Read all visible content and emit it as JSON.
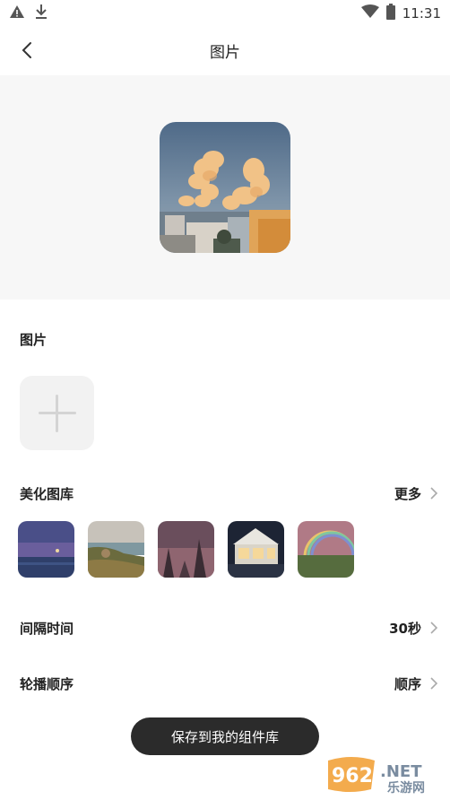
{
  "status_bar": {
    "time": "11:31",
    "icons": [
      "warning-icon",
      "download-icon",
      "wifi-icon",
      "battery-icon"
    ]
  },
  "header": {
    "title": "图片"
  },
  "image_section": {
    "label": "图片"
  },
  "gallery": {
    "label": "美化图库",
    "more_label": "更多",
    "thumbnails": [
      "sea-moon",
      "coast-cliff",
      "pink-dusk",
      "lit-house",
      "rainbow-field"
    ]
  },
  "interval": {
    "label": "间隔时间",
    "value": "30秒"
  },
  "order": {
    "label": "轮播顺序",
    "value": "顺序"
  },
  "save_button": {
    "label": "保存到我的组件库"
  },
  "watermark": {
    "number": "962",
    "suffix": ".NET",
    "sub": "乐游网"
  },
  "colors": {
    "primary_button": "#2b2b2b",
    "preview_bg": "#f7f7f7",
    "add_tile_bg": "#f2f2f2"
  }
}
